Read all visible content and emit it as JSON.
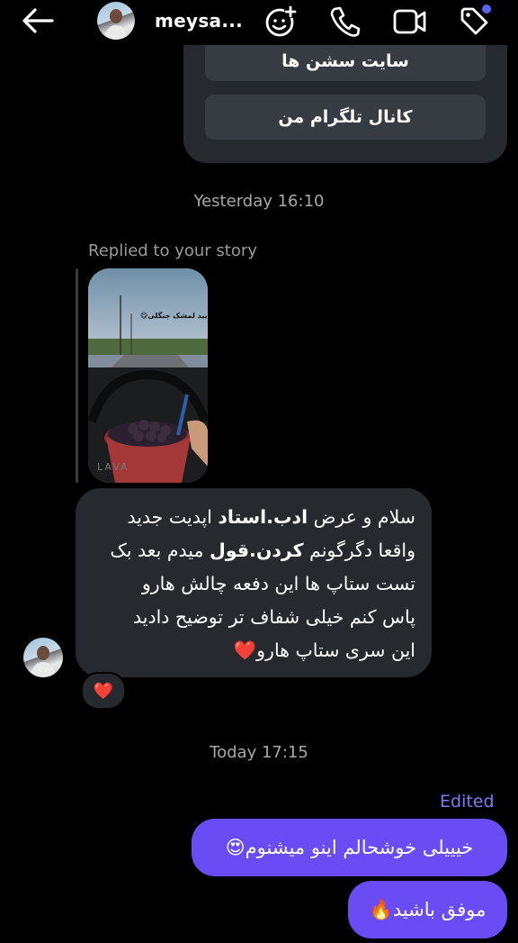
{
  "header": {
    "username": "meysa...",
    "icons": [
      "back-arrow-icon",
      "avatar",
      "add-effect-icon",
      "phone-icon",
      "video-icon",
      "tag-icon"
    ],
    "accent": "#5865f2"
  },
  "card": {
    "top_button_label": "سایت سشن ها",
    "telegram_button_label": "کانال تلگرام من"
  },
  "timestamps": {
    "yesterday": "Yesterday 16:10",
    "today": "Today 17:15"
  },
  "story_reply": {
    "label": "Replied to your story",
    "story_caption": "بفرمایید لمشک جنگلی😋",
    "watermark": "LAVA"
  },
  "incoming_message": {
    "line1_a": "سلام و عرض ",
    "line1_b": "ادب.استاد",
    "line1_c": " اپدیت جدید",
    "line2_a": "واقعا دگرگونم ",
    "line2_b": "کردن.قول",
    "line2_c": " میدم بعد بک",
    "line3": "تست ستاپ ها این دفعه چالش هارو",
    "line4": "پاس کنم خیلی شفاف تر توضیح دادید",
    "line5": "این سری ستاپ هارو",
    "line5_emoji": "❤️",
    "reaction": "❤️"
  },
  "outgoing": {
    "edited_label": "Edited",
    "msg1": "خیییلی خوشحالم اینو میشنوم",
    "msg1_emoji": "😍",
    "msg2": "موفق باشید",
    "msg2_emoji": "🔥",
    "bubble_color": "#6a4cf5"
  },
  "colors": {
    "background": "#000000",
    "incoming_bubble": "#262a2f",
    "edited_text": "#7c7cf8"
  }
}
